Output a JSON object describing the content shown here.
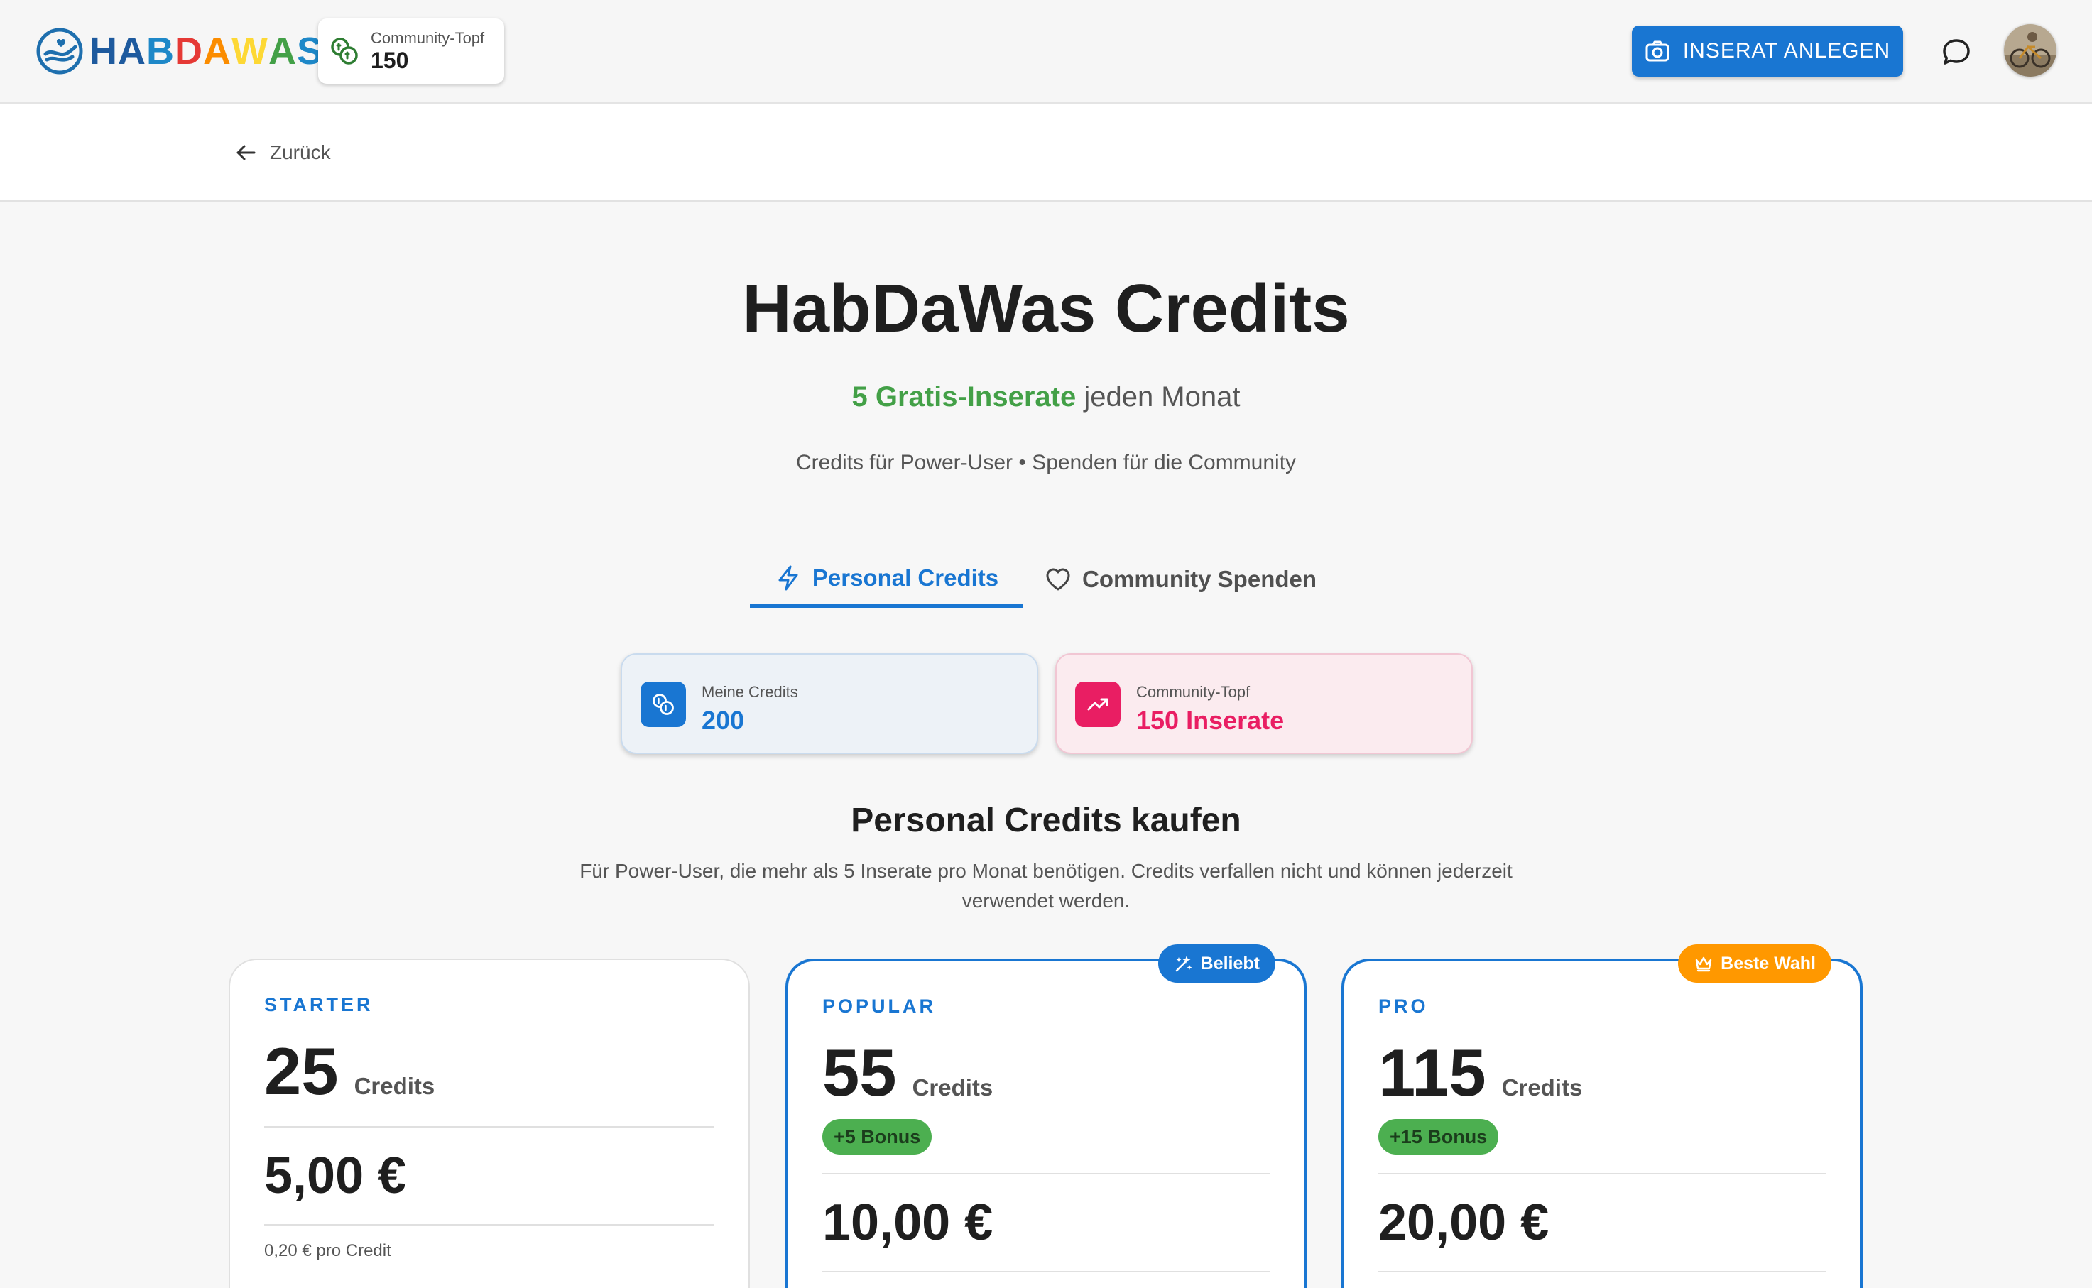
{
  "header": {
    "logo_letters": [
      {
        "ch": "H",
        "color": "#1e5a9e"
      },
      {
        "ch": "A",
        "color": "#1e5a9e"
      },
      {
        "ch": "B",
        "color": "#1e88c8"
      },
      {
        "ch": "D",
        "color": "#e53935"
      },
      {
        "ch": "A",
        "color": "#fb8c00"
      },
      {
        "ch": "W",
        "color": "#fdd835"
      },
      {
        "ch": "A",
        "color": "#43a047"
      },
      {
        "ch": "S",
        "color": "#1e88c8"
      }
    ],
    "pot_label": "Community-Topf",
    "pot_value": "150",
    "cta_label": "INSERAT ANLEGEN",
    "icons": {
      "pot": "coins-icon",
      "cta": "camera-icon",
      "chat": "chat-bubble-icon",
      "avatar": "user-avatar"
    }
  },
  "back": {
    "label": "Zurück",
    "icon": "arrow-left-icon"
  },
  "hero": {
    "title": "HabDaWas Credits",
    "highlight": "5 Gratis-Inserate",
    "highlight_rest": " jeden Monat",
    "subtitle": "Credits für Power-User • Spenden für die Community"
  },
  "tabs": [
    {
      "label": "Personal Credits",
      "icon": "lightning-icon",
      "active": true
    },
    {
      "label": "Community Spenden",
      "icon": "heart-icon",
      "active": false
    }
  ],
  "stats": {
    "mine": {
      "label": "Meine Credits",
      "value": "200",
      "icon": "coins-icon",
      "color": "#1976d2"
    },
    "pot": {
      "label": "Community-Topf",
      "value": "150 Inserate",
      "icon": "trending-up-icon",
      "color": "#e91e63"
    }
  },
  "section": {
    "title": "Personal Credits kaufen",
    "description": "Für Power-User, die mehr als 5 Inserate pro Monat benötigen. Credits verfallen nicht und können jederzeit verwendet werden."
  },
  "plans": [
    {
      "name": "STARTER",
      "amount": "25",
      "unit": "Credits",
      "bonus": "",
      "price": "5,00 €",
      "per_credit": "0,20 € pro Credit",
      "badge": ""
    },
    {
      "name": "POPULAR",
      "amount": "55",
      "unit": "Credits",
      "bonus": "+5 Bonus",
      "price": "10,00 €",
      "per_credit": "",
      "badge": "Beliebt",
      "badge_icon": "sparkle-icon"
    },
    {
      "name": "PRO",
      "amount": "115",
      "unit": "Credits",
      "bonus": "+15 Bonus",
      "price": "20,00 €",
      "per_credit": "",
      "badge": "Beste Wahl",
      "badge_icon": "crown-icon"
    }
  ]
}
